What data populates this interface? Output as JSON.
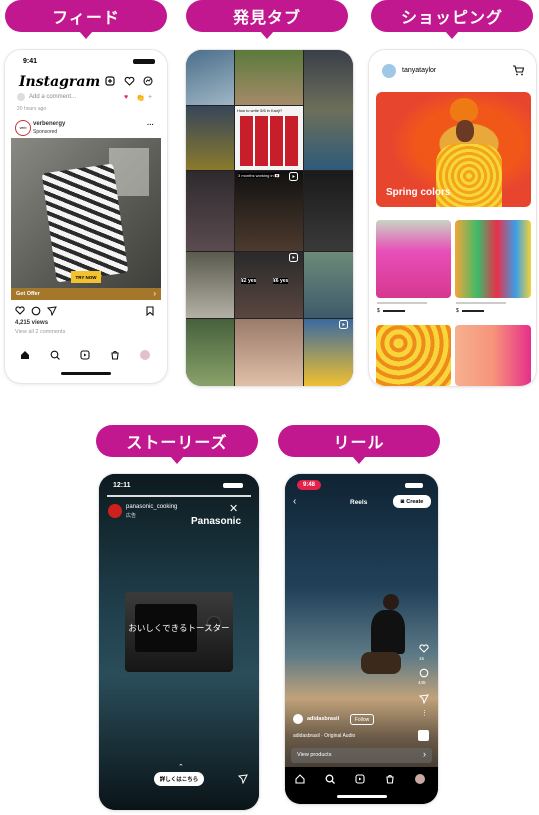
{
  "labels": {
    "feed": "フィード",
    "explore": "発見タブ",
    "shopping": "ショッピング",
    "stories": "ストーリーズ",
    "reels": "リール"
  },
  "feed": {
    "time": "9:41",
    "app_name": "Instagram",
    "comment_placeholder": "Add a comment...",
    "ago": "20 hours ago",
    "account": "verbenergy",
    "sponsored": "Sponsored",
    "product_text": "TRY NOW",
    "cta": "Get Offer",
    "views": "4,215 views",
    "comments": "View all 2 comments"
  },
  "explore": {
    "captions": [
      "How to write 5/6 in Kanji?",
      "3 months working in 🇯🇵",
      "¥2 yes",
      "¥6 yes"
    ]
  },
  "shopping": {
    "account": "tanyataylor",
    "hero": "Spring colors",
    "price": "$"
  },
  "stories": {
    "time": "12:11",
    "account": "panasonic_cooking",
    "ad": "広告",
    "brand": "Panasonic",
    "caption": "おいしくできるトースター",
    "cta": "詳しくはこちら"
  },
  "reels": {
    "time": "9:48",
    "title": "Reels",
    "create": "Create",
    "account": "adidasbrasil",
    "follow": "Follow",
    "audio": "adidasbrasil · Original Audio",
    "view_products": "View products",
    "likes": "15",
    "comments": "445"
  },
  "colors": {
    "accent": "#c2188f"
  }
}
